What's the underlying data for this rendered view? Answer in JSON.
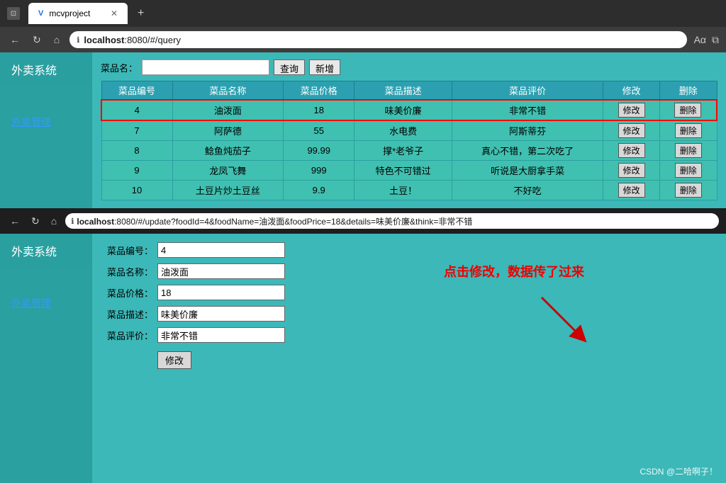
{
  "browser1": {
    "tab_label": "mcvproject",
    "url": "localhost:8080/#/query",
    "url_bold": "localhost",
    "url_rest": ":8080/#/query"
  },
  "browser2": {
    "url_bold": "localhost",
    "url_rest": ":8080/#/update?foodId=4&foodName=油泼面&foodPrice=18&details=味美价廉&think=非常不错"
  },
  "app1": {
    "title": "外卖系统",
    "sidebar_link": "外卖管理",
    "search_label": "菜品名：",
    "search_placeholder": "",
    "btn_query": "查询",
    "btn_add": "新增",
    "table": {
      "headers": [
        "菜品编号",
        "菜品名称",
        "菜品价格",
        "菜品描述",
        "菜品评价",
        "修改",
        "删除"
      ],
      "rows": [
        {
          "id": "4",
          "name": "油泼面",
          "price": "18",
          "desc": "味美价廉",
          "review": "非常不错",
          "highlight": true
        },
        {
          "id": "7",
          "name": "阿萨德",
          "price": "55",
          "desc": "水电费",
          "review": "阿斯蒂芬",
          "highlight": false
        },
        {
          "id": "8",
          "name": "鲶鱼炖茄子",
          "price": "99.99",
          "desc": "撑*老爷子",
          "review": "真心不错，第二次吃了",
          "highlight": false
        },
        {
          "id": "9",
          "name": "龙凤飞舞",
          "price": "999",
          "desc": "特色不可错过",
          "review": "听说是大厨拿手菜",
          "highlight": false
        },
        {
          "id": "10",
          "name": "土豆片炒土豆丝",
          "price": "9.9",
          "desc": "土豆！",
          "review": "不好吃",
          "highlight": false
        }
      ]
    }
  },
  "app2": {
    "title": "外卖系统",
    "sidebar_link": "外卖管理",
    "annotation": "点击修改，数据传了过来",
    "form": {
      "food_id_label": "菜品编号：",
      "food_id_value": "4",
      "food_name_label": "菜品名称：",
      "food_name_value": "油泼面",
      "food_price_label": "菜品价格：",
      "food_price_value": "18",
      "food_desc_label": "菜品描述：",
      "food_desc_value": "味美价廉",
      "food_review_label": "菜品评价：",
      "food_review_value": "非常不错",
      "btn_modify": "修改"
    }
  },
  "watermark": "CSDN @二哈啊子！",
  "btn_edit": "修改",
  "btn_delete": "删除"
}
